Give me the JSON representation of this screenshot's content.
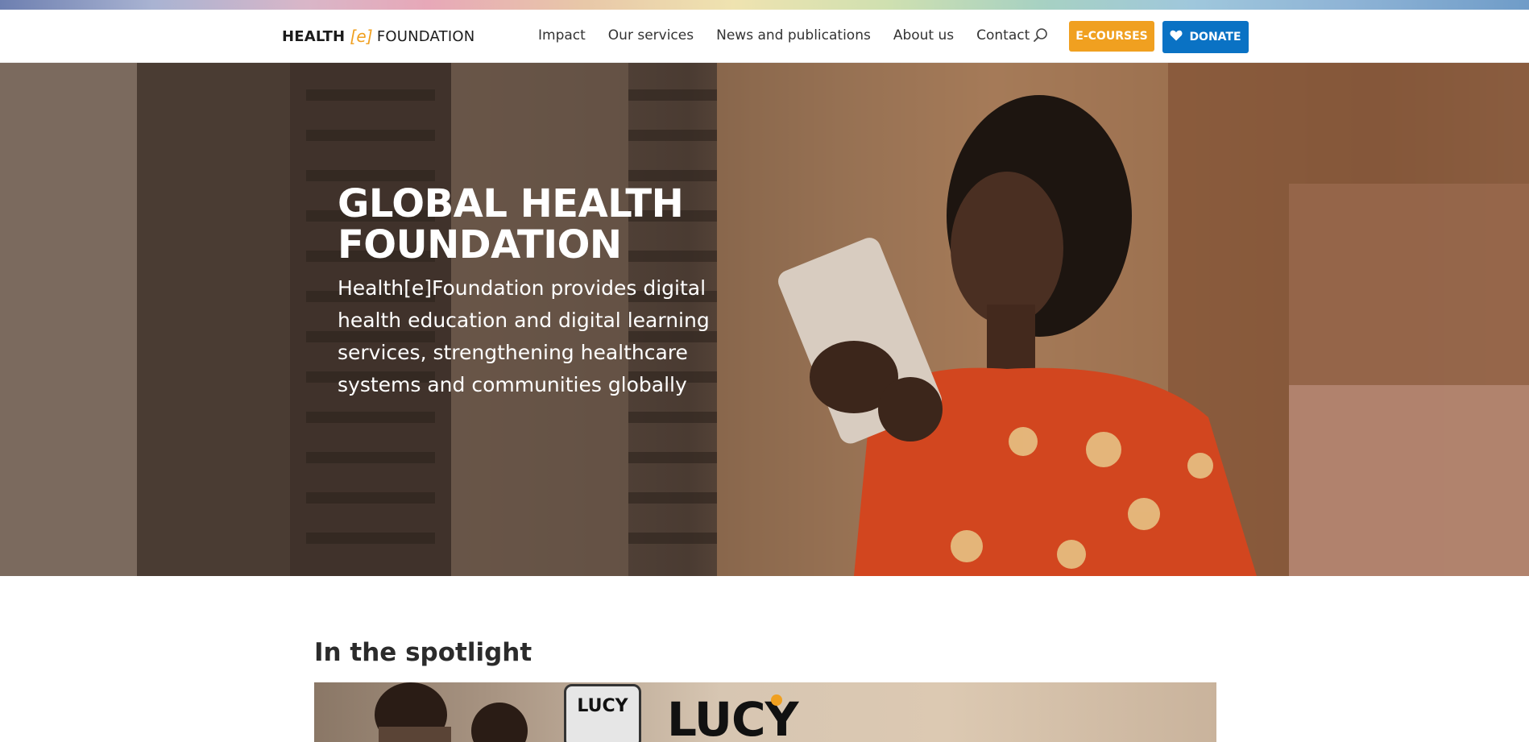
{
  "header": {
    "logo": {
      "part1": "HEALTH",
      "mark": "[e]",
      "part2": "FOUNDATION"
    },
    "nav": [
      "Impact",
      "Our services",
      "News and publications",
      "About us",
      "Contact"
    ],
    "search_icon": "search-icon",
    "ecourses_label": "E-COURSES",
    "donate_label": "DONATE",
    "donate_icon": "heart-icon"
  },
  "hero": {
    "title": "GLOBAL HEALTH FOUNDATION",
    "text": "Health[e]Foundation provides digital health education and digital learning services, strengthening healthcare systems and communities globally"
  },
  "spotlight": {
    "title": "In the spotlight",
    "card_badge": "LUCY",
    "card_title": "LUCY"
  },
  "colors": {
    "brand_orange": "#f0a020",
    "donate_blue": "#0a72c4",
    "text_dark": "#2b2b2b"
  }
}
